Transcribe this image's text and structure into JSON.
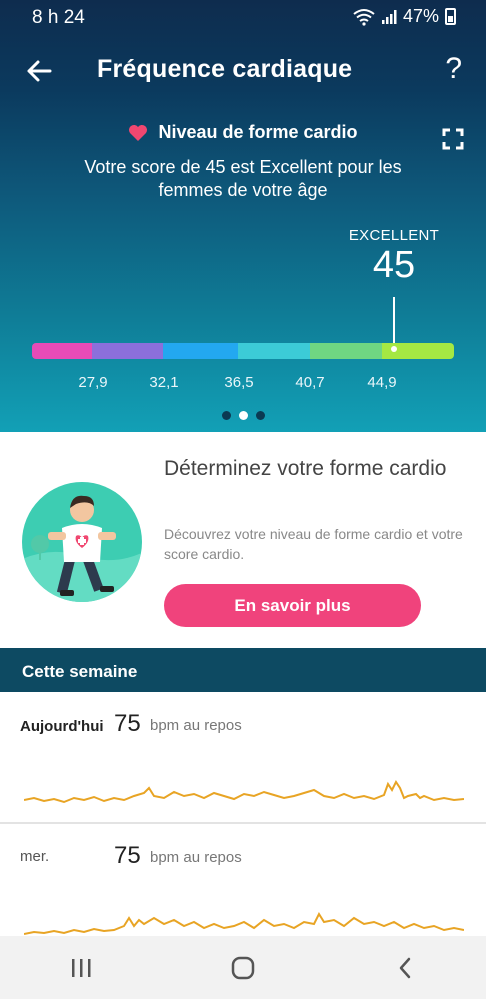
{
  "status": {
    "time": "8 h 24",
    "battery": "47%"
  },
  "appbar": {
    "title": "Fréquence cardiaque",
    "help": "?"
  },
  "cardio": {
    "title": "Niveau de forme cardio",
    "description": "Votre score de 45 est Excellent pour les femmes de votre âge",
    "level_label": "EXCELLENT",
    "score": "45",
    "score_value": 45,
    "ticks": [
      "27,9",
      "32,1",
      "36,5",
      "40,7",
      "44,9"
    ],
    "segment_colors": [
      "#e84bb7",
      "#8c6fdb",
      "#23a8f0",
      "#3ccbd7",
      "#6fd682",
      "#a5e843"
    ],
    "pager": {
      "count": 3,
      "active": 1
    }
  },
  "promo": {
    "title": "Déterminez votre forme cardio",
    "description": "Découvrez votre niveau de forme cardio et votre score cardio.",
    "button": "En savoir plus",
    "accent": "#f0437c"
  },
  "week": {
    "header": "Cette semaine",
    "days": [
      {
        "name": "Aujourd'hui",
        "bpm": "75",
        "unit": "bpm au repos"
      },
      {
        "name": "mer.",
        "bpm": "75",
        "unit": "bpm au repos"
      }
    ],
    "line_color": "#e8a424"
  },
  "navbar": {
    "icons": [
      "recent-apps-icon",
      "home-icon",
      "back-nav-icon"
    ]
  }
}
